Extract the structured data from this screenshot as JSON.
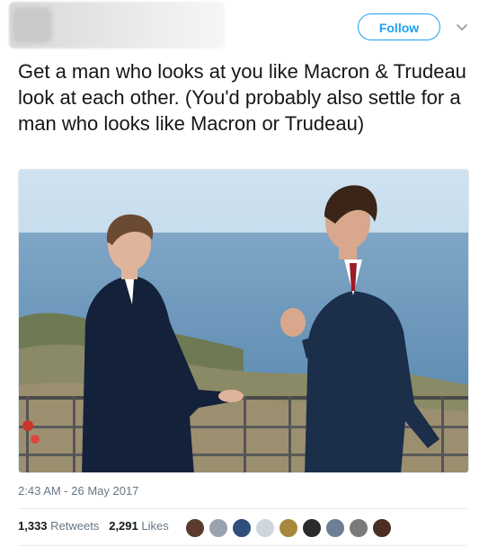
{
  "header": {
    "follow_label": "Follow"
  },
  "tweet": {
    "text": "Get a man who looks at you like Macron & Trudeau look at each other. (You'd probably also settle for a man who looks like Macron or Trudeau)",
    "timestamp": "2:43 AM - 26 May 2017"
  },
  "stats": {
    "retweets_count": "1,333",
    "retweets_label": "Retweets",
    "likes_count": "2,291",
    "likes_label": "Likes"
  },
  "colors": {
    "accent": "#1da1f2",
    "text": "#14171a",
    "muted": "#657786"
  },
  "icons": {
    "chevron": "chevron-down-icon"
  }
}
